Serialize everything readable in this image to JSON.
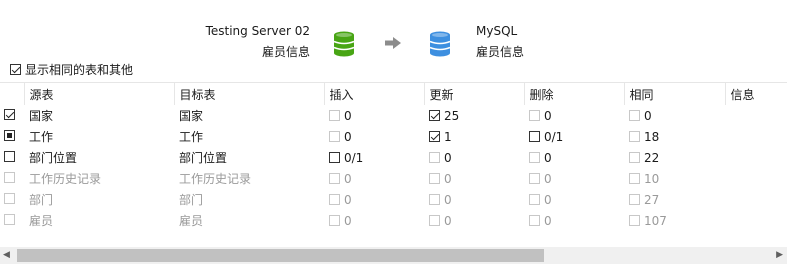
{
  "source": {
    "server": "Testing Server 02",
    "database": "雇员信息"
  },
  "target": {
    "server": "MySQL",
    "database": "雇员信息"
  },
  "colors": {
    "source_db": "#48a514",
    "target_db": "#3d8fe0",
    "arrow": "#8c8c8c"
  },
  "icons": {
    "source": "database-icon",
    "arrow": "arrow-right-icon",
    "target": "database-icon"
  },
  "show_same_label": "显示相同的表和其他",
  "show_same_checked": true,
  "columns": [
    "",
    "源表",
    "目标表",
    "插入",
    "更新",
    "删除",
    "相同",
    "信息"
  ],
  "rows": [
    {
      "state": "checked",
      "enabled": true,
      "source": "国家",
      "target": "国家",
      "insert": {
        "checked": false,
        "value": "0"
      },
      "update": {
        "checked": true,
        "value": "25"
      },
      "delete": {
        "checked": false,
        "value": "0"
      },
      "same": {
        "checked": false,
        "value": "0"
      },
      "info": ""
    },
    {
      "state": "indeterminate",
      "enabled": true,
      "source": "工作",
      "target": "工作",
      "insert": {
        "checked": false,
        "value": "0"
      },
      "update": {
        "checked": true,
        "value": "1"
      },
      "delete": {
        "checked": false,
        "value": "0/1"
      },
      "same": {
        "checked": false,
        "value": "18"
      },
      "info": ""
    },
    {
      "state": "unchecked",
      "enabled": true,
      "source": "部门位置",
      "target": "部门位置",
      "insert": {
        "checked": false,
        "value": "0/1"
      },
      "update": {
        "checked": false,
        "value": "0"
      },
      "delete": {
        "checked": false,
        "value": "0"
      },
      "same": {
        "checked": false,
        "value": "22"
      },
      "info": ""
    },
    {
      "state": "unchecked",
      "enabled": false,
      "source": "工作历史记录",
      "target": "工作历史记录",
      "insert": {
        "checked": false,
        "value": "0"
      },
      "update": {
        "checked": false,
        "value": "0"
      },
      "delete": {
        "checked": false,
        "value": "0"
      },
      "same": {
        "checked": false,
        "value": "10"
      },
      "info": ""
    },
    {
      "state": "unchecked",
      "enabled": false,
      "source": "部门",
      "target": "部门",
      "insert": {
        "checked": false,
        "value": "0"
      },
      "update": {
        "checked": false,
        "value": "0"
      },
      "delete": {
        "checked": false,
        "value": "0"
      },
      "same": {
        "checked": false,
        "value": "27"
      },
      "info": ""
    },
    {
      "state": "unchecked",
      "enabled": false,
      "source": "雇员",
      "target": "雇员",
      "insert": {
        "checked": false,
        "value": "0"
      },
      "update": {
        "checked": false,
        "value": "0"
      },
      "delete": {
        "checked": false,
        "value": "0"
      },
      "same": {
        "checked": false,
        "value": "107"
      },
      "info": ""
    }
  ]
}
